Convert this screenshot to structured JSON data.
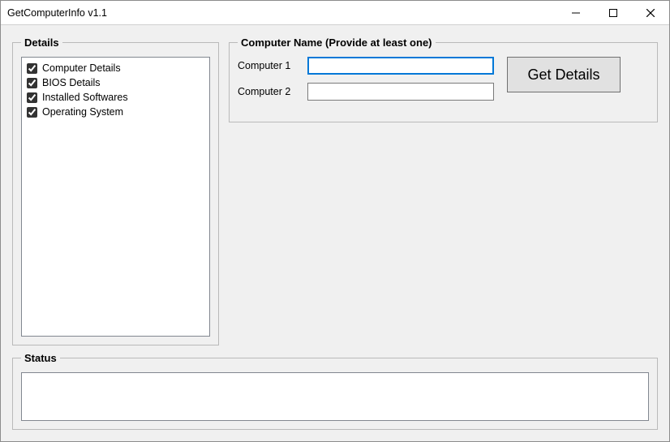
{
  "window": {
    "title": "GetComputerInfo v1.1"
  },
  "details": {
    "legend": "Details",
    "items": [
      {
        "label": "Computer Details",
        "checked": true
      },
      {
        "label": "BIOS Details",
        "checked": true
      },
      {
        "label": "Installed Softwares",
        "checked": true
      },
      {
        "label": "Operating System",
        "checked": true
      }
    ]
  },
  "computerName": {
    "legend": "Computer Name (Provide at least one)",
    "fields": [
      {
        "label": "Computer 1",
        "value": ""
      },
      {
        "label": "Computer 2",
        "value": ""
      }
    ],
    "buttonLabel": "Get Details"
  },
  "status": {
    "legend": "Status",
    "text": ""
  }
}
